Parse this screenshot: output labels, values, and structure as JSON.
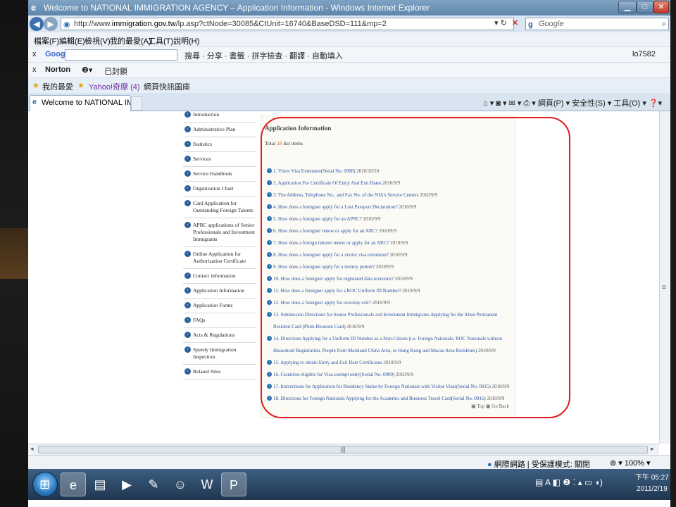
{
  "window": {
    "title": "Welcome to NATIONAL IMMIGRATION AGENCY – Application Information - Windows Internet Explorer",
    "url_prefix": "http://www.",
    "url_host": "immigration.gov.tw",
    "url_path": "/lp.asp?ctNode=30085&CtUnit=16740&BaseDSD=111&mp=2",
    "search_placeholder": "Google"
  },
  "menubar": [
    "檔案(F)",
    "編輯(E)",
    "檢視(V)",
    "我的最愛(A)",
    "工具(T)",
    "說明(H)"
  ],
  "google_toolbar": {
    "label": "Google",
    "buttons": "搜尋 · 分享 · 書籤 · 拼字檢查 · 翻譯 · 自動填入",
    "user": "lo7582"
  },
  "norton_toolbar": {
    "label": "Norton",
    "status": "已封鎖"
  },
  "favorites_bar": {
    "favorites": "我的最愛",
    "yahoo": "Yahoo!奇摩 (4)",
    "webslice": "網頁快訊圖庫"
  },
  "tab": {
    "label": "Welcome to NATIONAL IMM..."
  },
  "command_bar": "網頁(P) ▾  安全性(S) ▾  工具(O) ▾",
  "sidenav": [
    "Introduction",
    "Administrative Plan",
    "Statistics",
    "Services",
    "Service Handbook",
    "Organization Chart",
    "Card Application for Outstanding Foreign Talents",
    "APRC applications of Senior Professionals and Investment Immigrants",
    "Online Application for Authorization Certificate",
    "Contact information",
    "Application Information",
    "Application Forms",
    "FAQs",
    "Acts & Regulations",
    "Speedy Immigration Inspection",
    "Related Sites"
  ],
  "panel": {
    "title": "Application Information",
    "total_prefix": "Total ",
    "total_count": "18",
    "total_suffix": " list items",
    "back_to_top": "Top",
    "go_back": "Go Back"
  },
  "items": [
    {
      "text": "1.  Vistor Visa Extension(Serial No. 0908)",
      "date": "2010/10/20"
    },
    {
      "text": "2.  Application For Certificate Of Entry And Exit Dates",
      "date": "2010/9/9"
    },
    {
      "text": "3.  The Address, Telephone No., and Fax No. of the NIA's Service Centers",
      "date": "2010/9/9"
    },
    {
      "text": "4.  How does a foreigner apply for a Lost Passport Declaration?",
      "date": "2010/9/9"
    },
    {
      "text": "5.  How does a foreigner apply for an APRC?",
      "date": "2010/9/9"
    },
    {
      "text": "6.  How does a foreigner renew or apply for an ARC?",
      "date": "2010/9/9"
    },
    {
      "text": "7.  How does a foreign laborer renew or apply for an ARC?",
      "date": "2010/9/9"
    },
    {
      "text": "8.  How does a foreigner apply for a visitor visa extension?",
      "date": "2010/9/9"
    },
    {
      "text": "9.  How does a foreigner apply for a reentry permit?",
      "date": "2010/9/9"
    },
    {
      "text": "10.  How does a foreigner apply for registered data revisions?",
      "date": "2010/9/9"
    },
    {
      "text": "11.  How does a foreigner apply for a ROC Uniform ID Number?",
      "date": "2010/9/9"
    },
    {
      "text": "12.  How does a foreigner apply for overstay exit?",
      "date": "2010/9/9"
    },
    {
      "text": "13.  Submission Directions for Senior Professionals and Investment Immigrants Applying for the Alien Permanent Resident Card (Plum Blossom Card)",
      "date": "2010/9/9"
    },
    {
      "text": "14.  Directions Applying for a Uniform ID Number as a Non-Citizen (i.e. Foreign Nationals, ROC Nationals without Household Registration, People from Mainland China Area, or Hong Kong and Macau Area Residents)",
      "date": "2010/9/9"
    },
    {
      "text": "15.  Applying to obtain Entry and Exit Date Certificates",
      "date": "2010/9/9"
    },
    {
      "text": "16.  Countries eligible for Visa-exempt entry(Serial No. 0909)",
      "date": "2010/9/9"
    },
    {
      "text": "17.  Instructions for Application for Residency Status by Foreign Nationals with Visitor Visas(Serial No. 0915)",
      "date": "2010/9/9"
    },
    {
      "text": "18.  Directions for Foreign Nationals Applying for the Academic and Business Travel Card(Serial No. 0916)",
      "date": "2010/9/9"
    }
  ],
  "statusbar": {
    "zone": "網際網路 | 受保護模式: 關閉",
    "zoom": "100%"
  },
  "clock": {
    "time": "下午 05:27",
    "date": "2011/2/19"
  },
  "colors": {
    "highlight_ring": "#e01b1b",
    "link": "#2b53a3",
    "count": "#d1601a"
  }
}
